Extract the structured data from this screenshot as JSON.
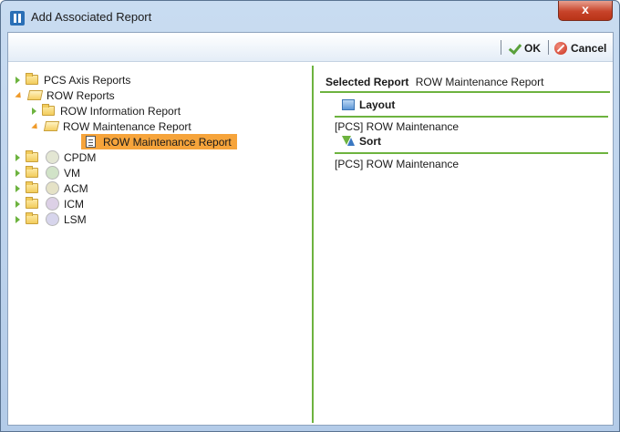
{
  "window": {
    "title": "Add Associated Report",
    "close_label": "x"
  },
  "toolbar": {
    "ok_label": "OK",
    "cancel_label": "Cancel"
  },
  "tree": {
    "items": [
      {
        "label": "PCS Axis Reports"
      },
      {
        "label": "ROW Reports"
      },
      {
        "label": "ROW Information Report"
      },
      {
        "label": "ROW Maintenance Report"
      },
      {
        "label": "ROW Maintenance Report"
      },
      {
        "label": "CPDM"
      },
      {
        "label": "VM"
      },
      {
        "label": "ACM"
      },
      {
        "label": "ICM"
      },
      {
        "label": "LSM"
      }
    ]
  },
  "details": {
    "selected_report_label": "Selected Report",
    "selected_report_value": "ROW Maintenance Report",
    "layout_label": "Layout",
    "layout_value": "[PCS] ROW Maintenance",
    "sort_label": "Sort",
    "sort_value": "[PCS] ROW Maintenance"
  },
  "colors": {
    "accent_green": "#6db33f",
    "selection_orange": "#f6a43b",
    "cpdm": "#e3e6d3",
    "vm": "#d1e3c8",
    "acm": "#e5e2c7",
    "icm": "#dcd0e6",
    "lsm": "#d7d5ec"
  }
}
